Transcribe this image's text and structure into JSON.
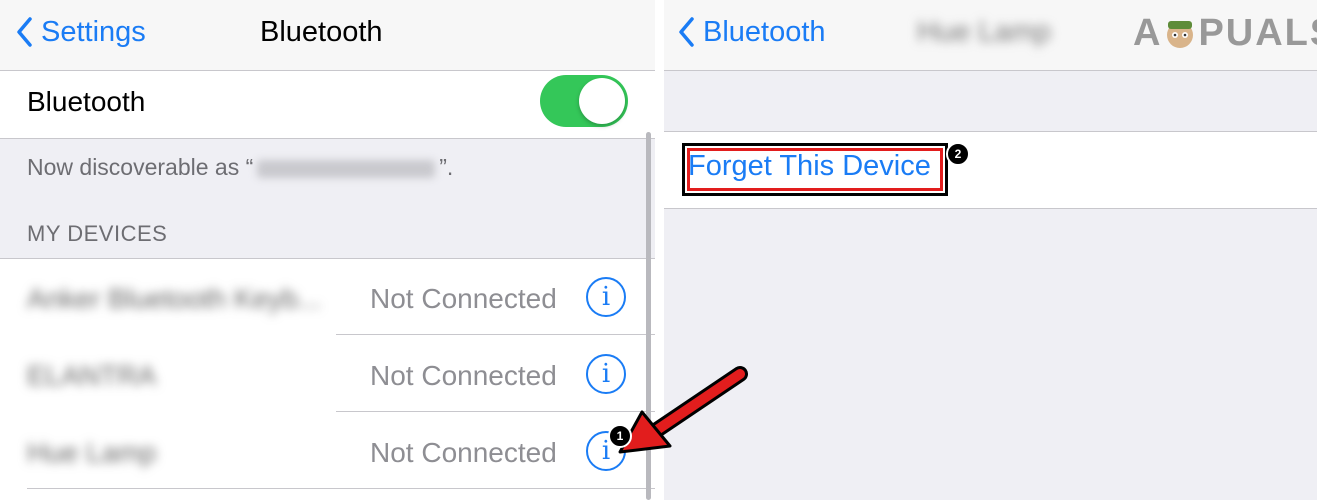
{
  "left": {
    "nav": {
      "back_label": "Settings",
      "title": "Bluetooth"
    },
    "bluetooth_row": {
      "label": "Bluetooth",
      "toggle_on": true
    },
    "discoverable": {
      "prefix": "Now discoverable as “",
      "suffix": "”."
    },
    "section_header": "MY DEVICES",
    "devices": [
      {
        "name": "Anker Bluetooth Keyb...",
        "status": "Not Connected"
      },
      {
        "name": "ELANTRA",
        "status": "Not Connected"
      },
      {
        "name": "Hue Lamp",
        "status": "Not Connected"
      }
    ]
  },
  "right": {
    "nav": {
      "back_label": "Bluetooth",
      "title": "Hue Lamp"
    },
    "forget_label": "Forget This Device"
  },
  "annotations": {
    "step1": "1",
    "step2": "2"
  },
  "watermark": {
    "left": "A",
    "right": "PUALS"
  },
  "colors": {
    "ios_blue": "#1a7cf5",
    "toggle_green": "#34c759",
    "highlight_red": "#e21d1d"
  }
}
